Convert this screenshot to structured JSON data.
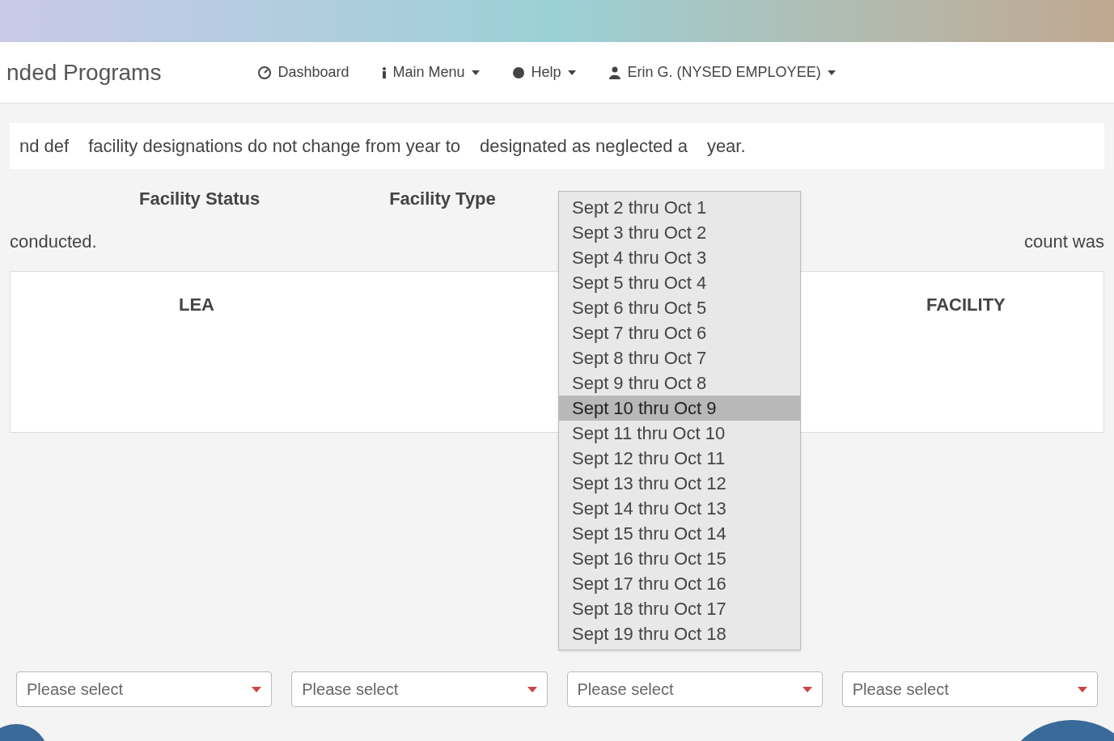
{
  "header": {
    "title": "nded Programs",
    "nav": [
      {
        "label": "Dashboard",
        "caret": false
      },
      {
        "label": "Main Menu",
        "caret": true
      },
      {
        "label": "Help",
        "caret": true
      },
      {
        "label": "Erin G. (NYSED EMPLOYEE)",
        "caret": true
      }
    ]
  },
  "notice": {
    "lines": [
      "nd def",
      "facility designations do not change from year to",
      "designated as neglected a",
      "year."
    ]
  },
  "fields": [
    {
      "label": "Facility Status"
    },
    {
      "label": "Facility Type"
    }
  ],
  "note": {
    "lines": [
      "conducted.",
      "count was"
    ]
  },
  "table": {
    "columns": [
      "LEA",
      "FACILITY"
    ]
  },
  "dropdown": {
    "options": [
      {
        "label": "Sept 2 thru Oct 1",
        "selected": false
      },
      {
        "label": "Sept 3 thru Oct 2",
        "selected": false
      },
      {
        "label": "Sept 4 thru Oct 3",
        "selected": false
      },
      {
        "label": "Sept 5 thru Oct 4",
        "selected": false
      },
      {
        "label": "Sept 6 thru Oct 5",
        "selected": false
      },
      {
        "label": "Sept 7 thru Oct 6",
        "selected": false
      },
      {
        "label": "Sept 8 thru Oct 7",
        "selected": false
      },
      {
        "label": "Sept 9 thru Oct 8",
        "selected": false
      },
      {
        "label": "Sept 10 thru Oct 9",
        "selected": true
      },
      {
        "label": "Sept 11 thru Oct 10",
        "selected": false
      },
      {
        "label": "Sept 12 thru Oct 11",
        "selected": false
      },
      {
        "label": "Sept 13 thru Oct 12",
        "selected": false
      },
      {
        "label": "Sept 14 thru Oct 13",
        "selected": false
      },
      {
        "label": "Sept 15 thru Oct 14",
        "selected": false
      },
      {
        "label": "Sept 16 thru Oct 15",
        "selected": false
      },
      {
        "label": "Sept 17 thru Oct 16",
        "selected": false
      },
      {
        "label": "Sept 18 thru Oct 17",
        "selected": false
      },
      {
        "label": "Sept 19 thru Oct 18",
        "selected": false
      }
    ]
  },
  "selects": [
    {
      "placeholder": "Please select"
    },
    {
      "placeholder": "Please select"
    },
    {
      "placeholder": "Please select"
    },
    {
      "placeholder": "Please select"
    }
  ]
}
